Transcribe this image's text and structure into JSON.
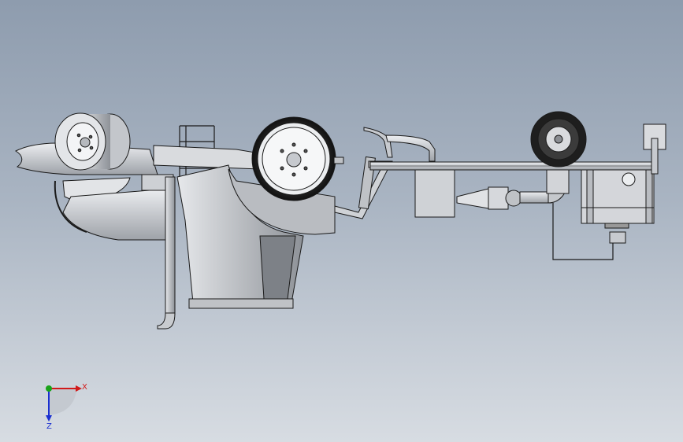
{
  "viewport": {
    "background_top": "#8e9cae",
    "background_bottom": "#d7dce2"
  },
  "model": {
    "stroke_color": "#1a1a1a",
    "body_fill": "#d2d5da",
    "shade_fill": "#8c8f95",
    "tire_fill": "#1e1e1e"
  },
  "triad": {
    "x_label": "X",
    "z_label": "Z",
    "x_color": "#d11a1a",
    "y_color": "#1aa31a",
    "z_color": "#1a2fd1"
  }
}
